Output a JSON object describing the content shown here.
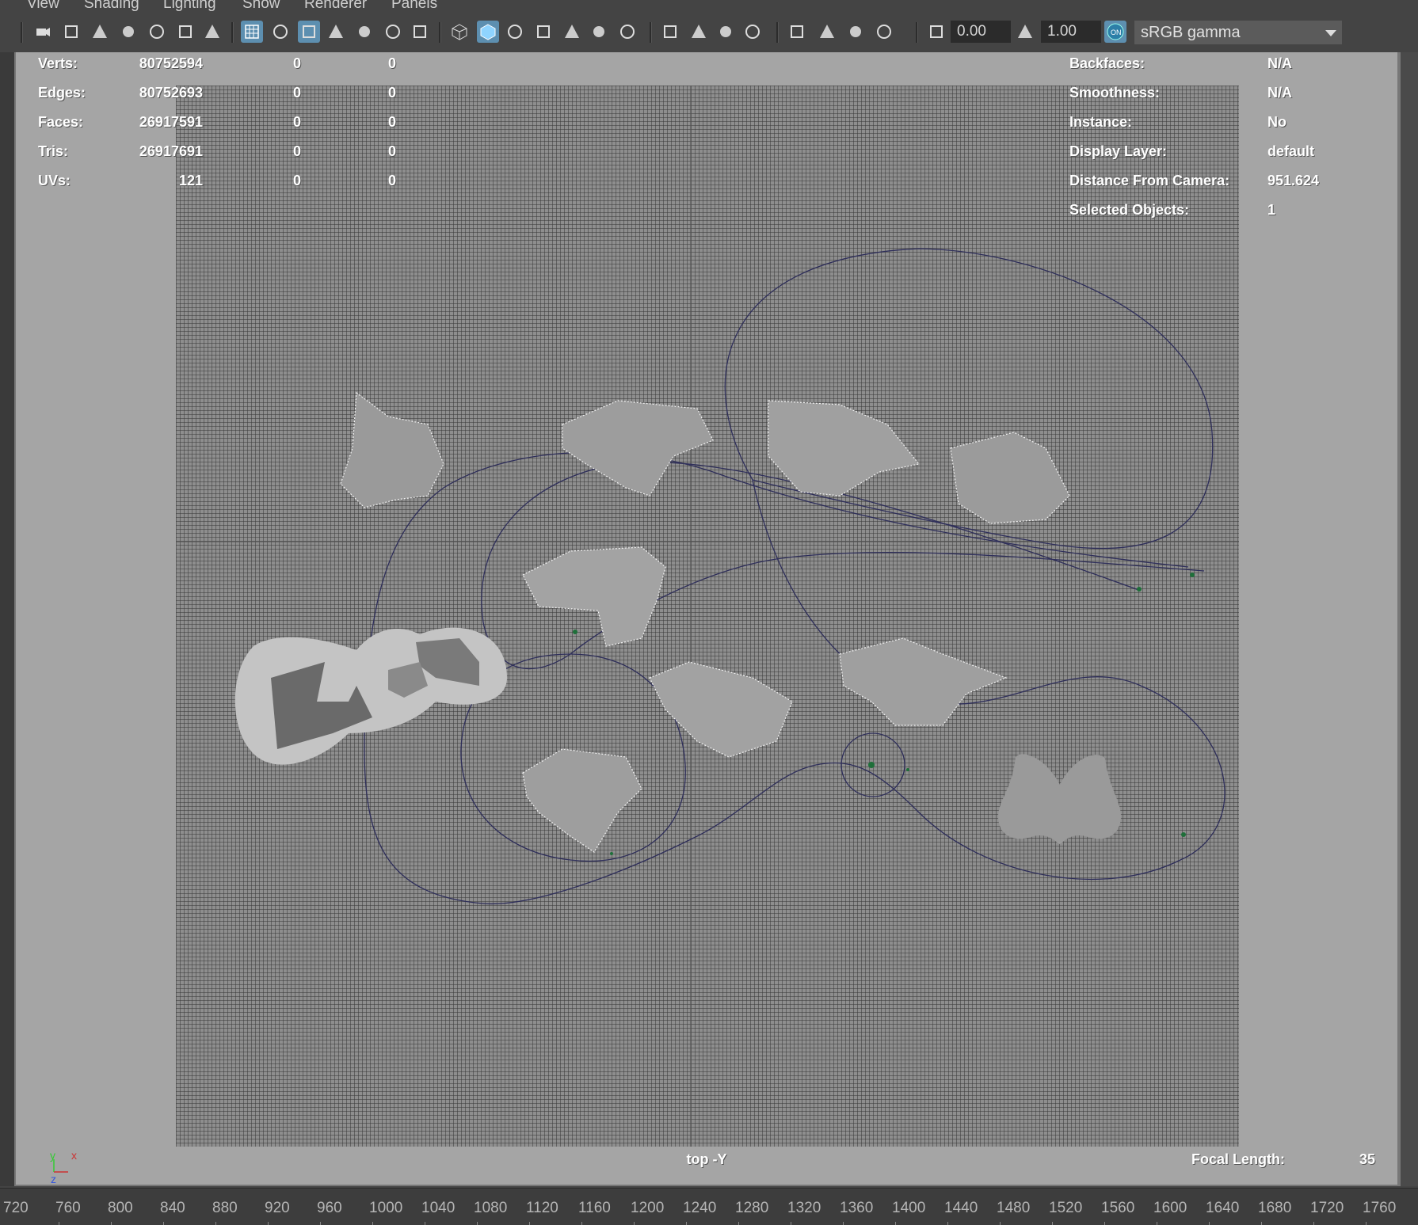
{
  "menu": [
    {
      "label": "View"
    },
    {
      "label": "Shading"
    },
    {
      "label": "Lighting"
    },
    {
      "label": "Show"
    },
    {
      "label": "Renderer"
    },
    {
      "label": "Panels"
    }
  ],
  "toolbar": {
    "exposure_value": "0.00",
    "gamma_value": "1.00",
    "color_management_badge": "ON",
    "view_transform": "sRGB gamma"
  },
  "hud": {
    "stats": [
      {
        "label": "Verts:",
        "total": "80752594",
        "selected": "0",
        "extra": "0"
      },
      {
        "label": "Edges:",
        "total": "80752693",
        "selected": "0",
        "extra": "0"
      },
      {
        "label": "Faces:",
        "total": "26917591",
        "selected": "0",
        "extra": "0"
      },
      {
        "label": "Tris:",
        "total": "26917691",
        "selected": "0",
        "extra": "0"
      },
      {
        "label": "UVs:",
        "total": "121",
        "selected": "0",
        "extra": "0"
      }
    ],
    "info": [
      {
        "label": "Backfaces:",
        "value": "N/A"
      },
      {
        "label": "Smoothness:",
        "value": "N/A"
      },
      {
        "label": "Instance:",
        "value": "No"
      },
      {
        "label": "Display Layer:",
        "value": "default"
      },
      {
        "label": "Distance From Camera:",
        "value": "951.624"
      },
      {
        "label": "Selected Objects:",
        "value": "1"
      }
    ],
    "camera_name": "top -Y",
    "focal_length_label": "Focal Length:",
    "focal_length_value": "35",
    "axis_labels": {
      "y": "y",
      "x": "x",
      "z": "z"
    }
  },
  "timeline": {
    "ticks": [
      "720",
      "760",
      "800",
      "840",
      "880",
      "920",
      "960",
      "1000",
      "1040",
      "1080",
      "1120",
      "1160",
      "1200",
      "1240",
      "1280",
      "1320",
      "1360",
      "1400",
      "1440",
      "1480",
      "1520",
      "1560",
      "1600",
      "1640",
      "1680",
      "1720",
      "1760"
    ]
  },
  "colors": {
    "active_icon": "#5d8fb0",
    "curve": "#2e2e5a",
    "locator": "#1f6f3a",
    "hud_text": "#ffffff"
  },
  "icons": [
    "camera-icon",
    "lock-camera-icon",
    "camera-attributes-icon",
    "bookmark-icon",
    "image-plane-icon",
    "2d-pan-zoom-icon",
    "grease-pencil-icon",
    "grid-icon",
    "film-gate-icon",
    "resolution-gate-icon",
    "gate-mask-icon",
    "field-chart-icon",
    "safe-action-icon",
    "safe-title-icon",
    "wireframe-icon",
    "smooth-shade-icon",
    "default-material-icon",
    "wireframe-on-shaded-icon",
    "textured-icon",
    "use-all-lights-icon",
    "shadows-icon",
    "screen-space-ao-icon",
    "motion-blur-icon",
    "multisample-aa-icon",
    "depth-of-field-icon",
    "isolate-select-icon",
    "xray-icon",
    "xray-active-icon",
    "xray-joints-icon",
    "exposure-icon",
    "gamma-icon",
    "color-management-icon"
  ]
}
